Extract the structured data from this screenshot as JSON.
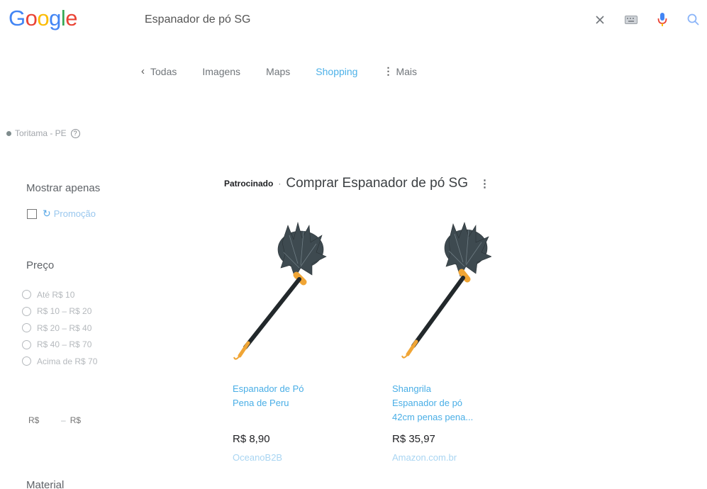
{
  "logo": {
    "letters": [
      "G",
      "o",
      "o",
      "g",
      "l",
      "e"
    ],
    "colors": [
      "#4285f4",
      "#ea4335",
      "#fbbc05",
      "#4285f4",
      "#34a853",
      "#ea4335"
    ]
  },
  "search": {
    "query": "Espanador de pó SG"
  },
  "icons": {
    "clear": "close-icon",
    "keyboard": "keyboard-icon",
    "voice": "mic-icon",
    "search": "search-icon"
  },
  "tabs": [
    {
      "label": "Todas"
    },
    {
      "label": "Imagens"
    },
    {
      "label": "Maps"
    },
    {
      "label": "Shopping",
      "active": true
    },
    {
      "label": "Mais"
    }
  ],
  "location": {
    "text": "Toritama - PE"
  },
  "sidebar": {
    "show_only_heading": "Mostrar apenas",
    "promo_label": "Promoção",
    "price_heading": "Preço",
    "price_options": [
      "Até R$ 10",
      "R$ 10 – R$ 20",
      "R$ 20 – R$ 40",
      "R$ 40 – R$ 70",
      "Acima de R$ 70"
    ],
    "range_min_placeholder": "R$",
    "range_sep": "–",
    "range_max_placeholder": "R$",
    "material_heading": "Material"
  },
  "sponsored": {
    "label": "Patrocinado",
    "separator": "·",
    "title": "Comprar Espanador de pó SG"
  },
  "products": [
    {
      "title_line1": "Espanador de Pó",
      "title_line2": "Pena de Peru",
      "title_line3": "",
      "price": "R$ 8,90",
      "store": "OceanoB2B"
    },
    {
      "title_line1": "Shangrila",
      "title_line2": "Espanador de pó",
      "title_line3": "42cm penas pena...",
      "price": "R$ 35,97",
      "store": "Amazon.com.br"
    }
  ],
  "accent_colors": {
    "link": "#49aee6",
    "active_tab": "#4db1e8"
  }
}
